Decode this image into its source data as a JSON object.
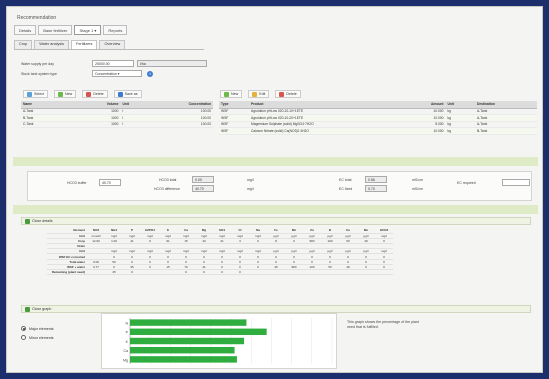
{
  "app": {
    "title": "Recommendation"
  },
  "nav": [
    {
      "label": "Details"
    },
    {
      "label": "Base fertilizer"
    },
    {
      "label": "Stage 1 ▾"
    },
    {
      "label": "Reports"
    }
  ],
  "tabs": [
    {
      "label": "Crop"
    },
    {
      "label": "Water analysis"
    },
    {
      "label": "Fertilizers"
    },
    {
      "label": "Overview"
    }
  ],
  "form": {
    "water_label": "Water supply per day",
    "water_value": "25000.00",
    "water_unit": "l/ha",
    "tank_label": "Stock tank system type",
    "tank_value": "Concentration ▾"
  },
  "left_toolbar": {
    "select": "Select",
    "new": "New",
    "delete": "Delete",
    "save": "Save as"
  },
  "right_toolbar": {
    "new": "New",
    "edit": "Edit",
    "delete": "Delete"
  },
  "left_table": {
    "headers": [
      "Name",
      "Volume",
      "Unit",
      "Concentration"
    ],
    "rows": [
      [
        "A-Tank",
        "1000",
        "l",
        "100.00"
      ],
      [
        "B-Tank",
        "1000",
        "l",
        "100.00"
      ],
      [
        "C-Tank",
        "1000",
        "l",
        "100.00"
      ]
    ]
  },
  "right_table": {
    "headers": [
      "Type",
      "Product",
      "Amount",
      "Unit",
      "Destination"
    ],
    "rows": [
      [
        "WSF",
        "Agrolution pHLow 020-10-10+1ETE",
        "10.000",
        "kg",
        "A-Tank"
      ],
      [
        "WSF",
        "Agrolution pHLow 020-10-20+1ETE",
        "10.000",
        "kg",
        "A-Tank"
      ],
      [
        "WSF",
        "Magnesium Sulphate (solid) MgSO4·7H2O",
        "5.000",
        "kg",
        "A-Tank"
      ],
      [
        "WSF",
        "Calcium Nitrate (solid) Ca(NO3)2 4H2O",
        "10.000",
        "kg",
        "B-Tank"
      ]
    ]
  },
  "buffer": {
    "hco3_label": "HCO3 buffer",
    "hco3_value": "40.70",
    "r1_label": "HCO3 total",
    "r1_value": "0.00",
    "r1_unit": "mg/l",
    "r2_label": "HCO3 difference",
    "r2_value": "40.70",
    "r2_unit": "mg/l",
    "r3_label": "EC total",
    "r3_value": "0.56",
    "r3_unit": "mS/cm",
    "r4_label": "EC fixed",
    "r4_value": "0.70",
    "r4_unit": "mS/cm",
    "req_label": "EC required",
    "req_value": ""
  },
  "details": {
    "toggle": "Close details",
    "cols": [
      "NO3",
      "NH4",
      "P",
      "H2PO4",
      "K",
      "Ca",
      "Mg",
      "SO4",
      "Cl",
      "Na",
      "Fe",
      "Mn",
      "Zn",
      "B",
      "Cu",
      "Mo",
      "HCO3"
    ],
    "rows": [
      {
        "label": "Element",
        "vals": [
          "NO3",
          "NH4",
          "P",
          "H2PO4",
          "K",
          "Ca",
          "Mg",
          "SO4",
          "Cl",
          "Na",
          "Fe",
          "Mn",
          "Zn",
          "B",
          "Cu",
          "Mo",
          "HCO3"
        ]
      },
      {
        "label": "Unit",
        "vals": [
          "mmol/l",
          "mg/l",
          "mg/l",
          "mg/l",
          "mg/l",
          "mg/l",
          "mg/l",
          "mg/l",
          "mg/l",
          "mg/l",
          "µg/l",
          "µg/l",
          "µg/l",
          "µg/l",
          "µg/l",
          "µg/l",
          "mg/l"
        ]
      },
      {
        "label": "Crop",
        "vals": [
          "12.90",
          "1.00",
          "41",
          "9",
          "91",
          "15",
          "43",
          "21",
          "3",
          "0",
          "8",
          "0",
          "983",
          "100",
          "50",
          "49",
          "0"
        ]
      },
      {
        "label": "Drain",
        "vals": [
          "",
          "",
          "",
          "",
          "",
          "",
          "",
          "",
          "",
          "",
          "",
          "",
          "",
          "",
          "",
          "",
          ""
        ]
      },
      {
        "label": "Unit",
        "vals": [
          "",
          "mg/l",
          "mg/l",
          "mg/l",
          "mg/l",
          "mg/l",
          "mg/l",
          "mg/l",
          "mg/l",
          "mg/l",
          "µg/l",
          "µg/l",
          "µg/l",
          "µg/l",
          "µg/l",
          "µg/l",
          "mg/l"
        ]
      },
      {
        "label": "WSF EC corrected",
        "vals": [
          "",
          "0",
          "0",
          "0",
          "0",
          "0",
          "0",
          "0",
          "0",
          "0",
          "0",
          "0",
          "0",
          "0",
          "0",
          "0",
          "0"
        ]
      },
      {
        "label": "Total water",
        "vals": [
          "0.00",
          "50",
          "0",
          "0",
          "0",
          "0",
          "0",
          "0",
          "0",
          "0",
          "0",
          "0",
          "0",
          "0",
          "0",
          "0",
          "0"
        ]
      },
      {
        "label": "WSF + water",
        "vals": [
          "0.77",
          "0",
          "35",
          "0",
          "15",
          "70",
          "41",
          "0",
          "0",
          "0",
          "45",
          "983",
          "100",
          "50",
          "49",
          "0",
          "0"
        ]
      },
      {
        "label": "Remaining (plant need)",
        "vals": [
          "",
          "45",
          "0",
          "",
          "",
          "0",
          "0",
          "0",
          "0",
          "",
          "",
          "",
          "",
          "",
          "",
          "",
          ""
        ]
      }
    ]
  },
  "graph": {
    "toggle": "Close graph",
    "radio_major": "Major elements",
    "radio_minor": "Minor elements",
    "note": "This graph shows the percentage of the plant need that is fulfilled.",
    "chart_data": {
      "type": "bar",
      "orientation": "horizontal",
      "categories": [
        "N",
        "P",
        "K",
        "Ca",
        "Mg"
      ],
      "values": [
        98,
        115,
        96,
        88,
        90
      ],
      "xlim": [
        0,
        170
      ]
    },
    "bar_color": "#2fae3f"
  }
}
